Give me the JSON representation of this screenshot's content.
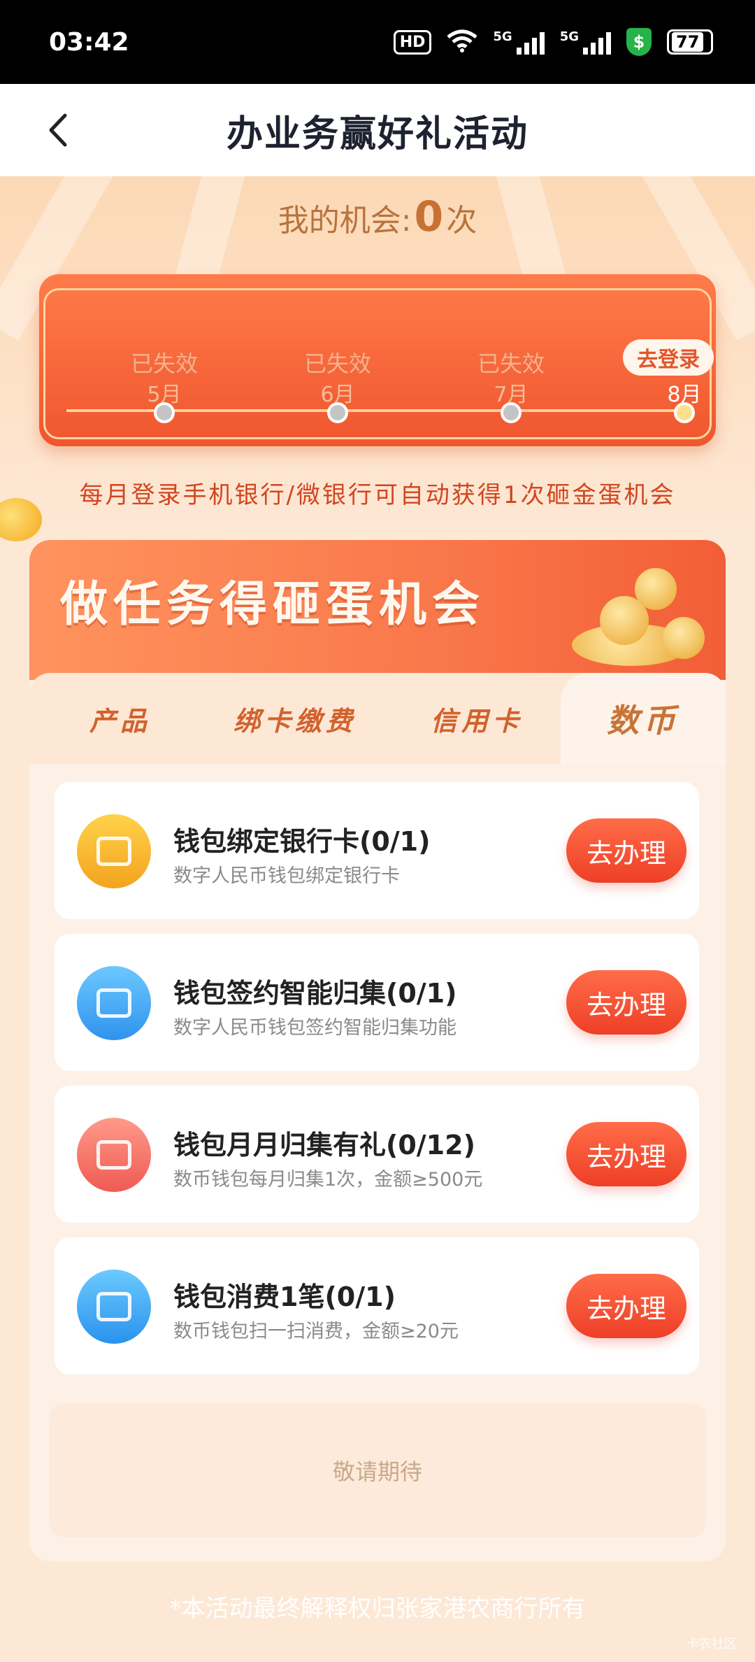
{
  "status_bar": {
    "time": "03:42",
    "hd_label": "HD",
    "net1": "5G",
    "net2": "5G",
    "shield_symbol": "$",
    "battery": "77"
  },
  "nav": {
    "back_icon": "chevron-left",
    "title": "办业务赢好礼活动"
  },
  "chance": {
    "label": "我的机会:",
    "count": "0",
    "unit": "次"
  },
  "timeline": {
    "months": [
      {
        "status": "已失效",
        "month": "5月"
      },
      {
        "status": "已失效",
        "month": "6月"
      },
      {
        "status": "已失效",
        "month": "7月"
      },
      {
        "status": "去登录",
        "month": "8月"
      }
    ]
  },
  "notice": "每月登录手机银行/微银行可自动获得1次砸金蛋机会",
  "panel": {
    "title": "做任务得砸蛋机会",
    "tabs": [
      "产品",
      "绑卡缴费",
      "信用卡",
      "数币"
    ],
    "active_tab": "数币",
    "tasks": [
      {
        "title": "钱包绑定银行卡(0/1)",
        "desc": "数字人民币钱包绑定银行卡",
        "button": "去办理",
        "icon": "link-card-icon",
        "color": "#f9b52a"
      },
      {
        "title": "钱包签约智能归集(0/1)",
        "desc": "数字人民币钱包签约智能归集功能",
        "button": "去办理",
        "icon": "download-box-icon",
        "color": "#3ea7f2"
      },
      {
        "title": "钱包月月归集有礼(0/12)",
        "desc": "数币钱包每月归集1次，金额≥500元",
        "button": "去办理",
        "icon": "calendar-return-icon",
        "color": "#f46a5c"
      },
      {
        "title": "钱包消费1笔(0/1)",
        "desc": "数币钱包扫一扫消费，金额≥20元",
        "button": "去办理",
        "icon": "shopping-bag-icon",
        "color": "#39a6ee"
      }
    ],
    "coming_soon": "敬请期待"
  },
  "footer": "*本活动最终解释权归张家港农商行所有",
  "watermark": "卡农社区"
}
